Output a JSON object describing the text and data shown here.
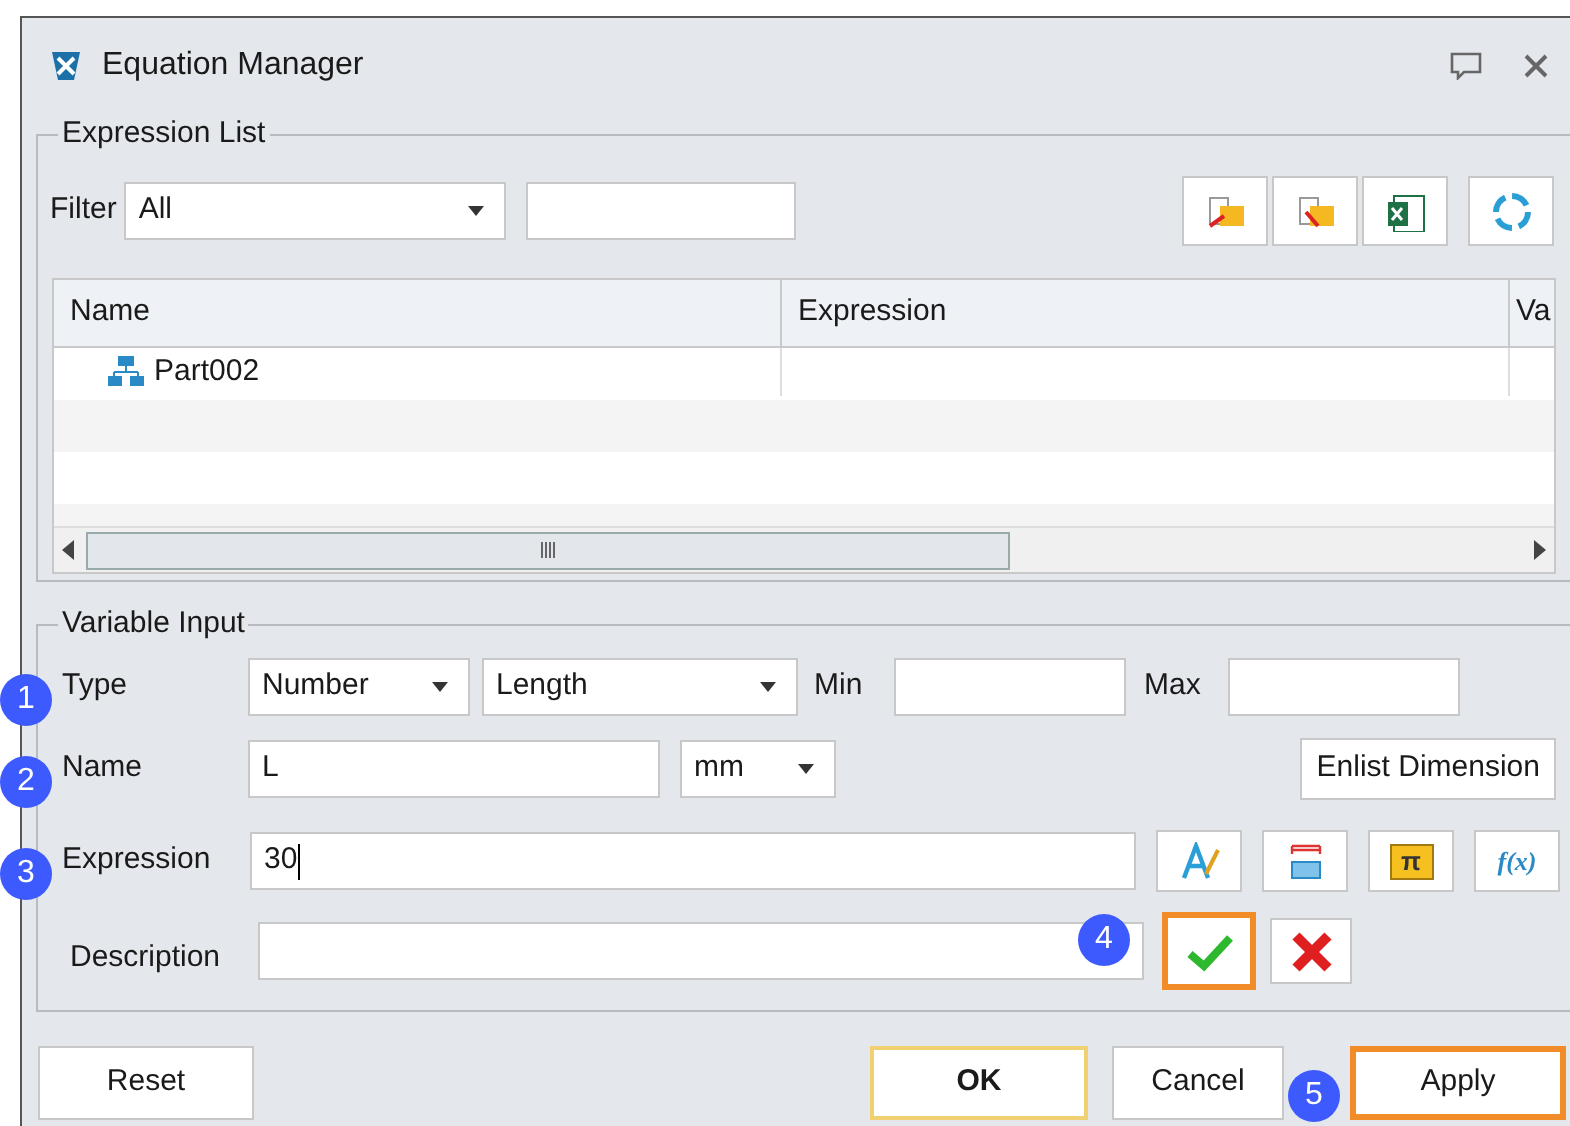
{
  "window": {
    "title": "Equation Manager"
  },
  "expression_list": {
    "title": "Expression List",
    "filter_label": "Filter",
    "filter_value": "All",
    "columns": [
      "Name",
      "Expression",
      "Va"
    ],
    "rows": [
      {
        "name": "Part002"
      }
    ]
  },
  "variable_input": {
    "title": "Variable Input",
    "type_label": "Type",
    "type_value": "Number",
    "subtype_value": "Length",
    "min_label": "Min",
    "max_label": "Max",
    "name_label": "Name",
    "name_value": "L",
    "unit_value": "mm",
    "enlist_button": "Enlist Dimension",
    "expression_label": "Expression",
    "expression_value": "30",
    "description_label": "Description",
    "tool_buttons": [
      {
        "kind": "text-style"
      },
      {
        "kind": "measure"
      },
      {
        "kind": "pi",
        "label": "π"
      },
      {
        "kind": "function",
        "label": "f(x)"
      }
    ],
    "confirm": {
      "highlighted": true
    },
    "discard": {
      "highlighted": false
    }
  },
  "buttons": [
    {
      "label": "Reset",
      "default": false,
      "highlighted": false
    },
    {
      "label": "OK",
      "default": true,
      "highlighted": false
    },
    {
      "label": "Cancel",
      "default": false,
      "highlighted": false
    },
    {
      "label": "Apply",
      "default": false,
      "highlighted": true
    }
  ],
  "callouts": [
    "1",
    "2",
    "3",
    "4",
    "5"
  ]
}
